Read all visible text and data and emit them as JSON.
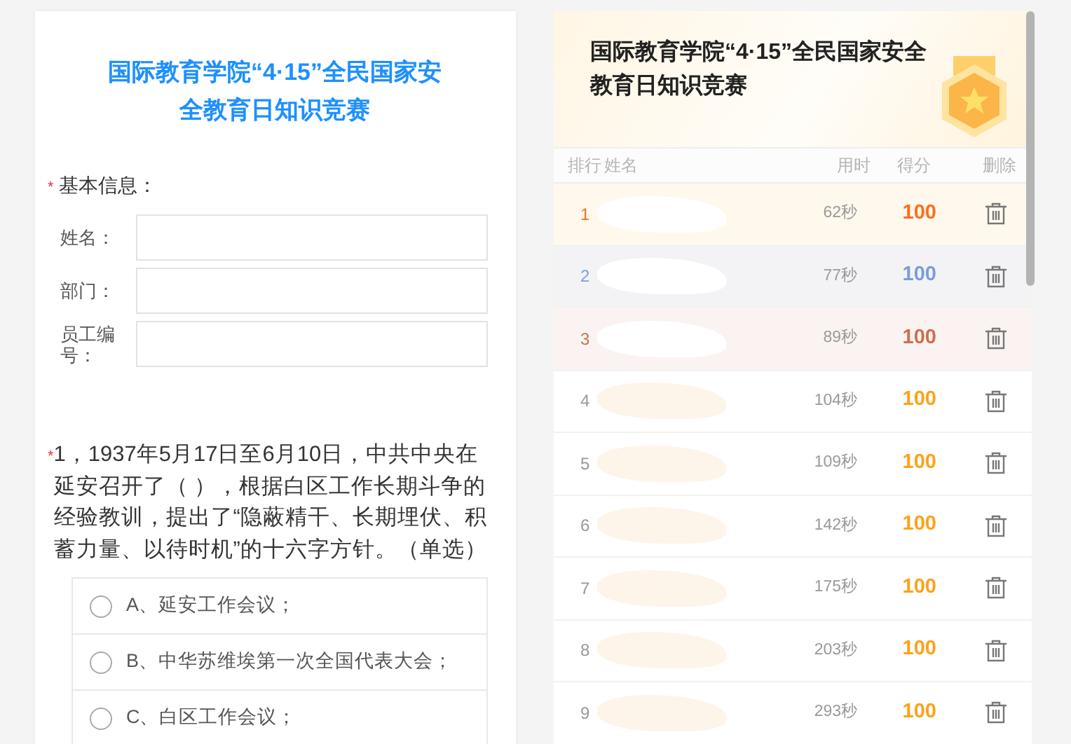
{
  "form": {
    "title": "国际教育学院“4·15”全民国家安全教育日知识竞赛",
    "basic_info": {
      "label": "基本信息：",
      "required_mark": "*",
      "fields": [
        {
          "label": "姓名："
        },
        {
          "label": "部门："
        },
        {
          "label": "员工编号："
        }
      ]
    },
    "question": {
      "required_mark": "*",
      "text": "1，1937年5月17日至6月10日，中共中央在延安召开了（ ），根据白区工作长期斗争的经验教训，提出了“隐蔽精干、长期埋伏、积蓄力量、以待时机”的十六字方针。（单选）",
      "options": [
        {
          "label": "A、延安工作会议；",
          "selected": false
        },
        {
          "label": "B、中华苏维埃第一次全国代表大会；",
          "selected": false
        },
        {
          "label": "C、白区工作会议；",
          "selected": false
        }
      ]
    }
  },
  "leaderboard": {
    "title": "国际教育学院“4·15”全民国家安全教育日知识竞赛",
    "columns": [
      "排行",
      "姓名",
      "用时",
      "得分",
      "删除"
    ],
    "rows": [
      {
        "kind": "gold",
        "rank": "1",
        "time": "62秒",
        "score": "100"
      },
      {
        "kind": "silver",
        "rank": "2",
        "time": "77秒",
        "score": "100"
      },
      {
        "kind": "bronze",
        "rank": "3",
        "time": "89秒",
        "score": "100"
      },
      {
        "kind": "plain",
        "rank": "4",
        "time": "104秒",
        "score": "100"
      },
      {
        "kind": "plain",
        "rank": "5",
        "time": "109秒",
        "score": "100"
      },
      {
        "kind": "plain",
        "rank": "6",
        "time": "142秒",
        "score": "100"
      },
      {
        "kind": "plain",
        "rank": "7",
        "time": "175秒",
        "score": "100"
      },
      {
        "kind": "plain",
        "rank": "8",
        "time": "203秒",
        "score": "100"
      },
      {
        "kind": "plain",
        "rank": "9",
        "time": "293秒",
        "score": "100"
      }
    ]
  }
}
